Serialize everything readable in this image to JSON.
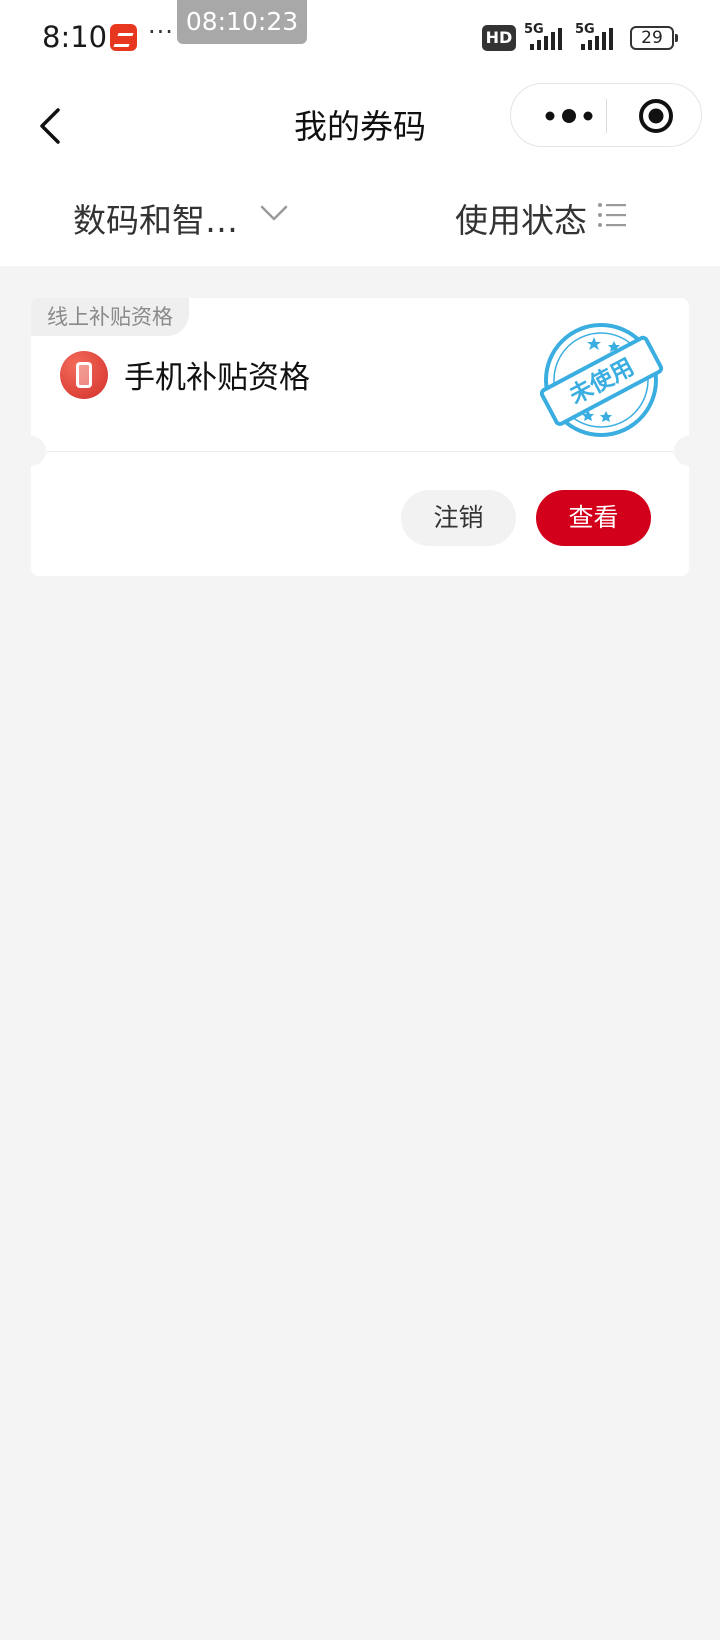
{
  "status_bar": {
    "time": "8:10",
    "overflow": "···",
    "clock_overlay": "08:10:23",
    "hd_label": "HD",
    "network1": "5G",
    "network2": "5G",
    "battery": "29"
  },
  "nav": {
    "title": "我的券码",
    "back_icon": "chevron-left-icon",
    "more_icon": "more-dots-icon",
    "close_icon": "target-circle-icon"
  },
  "filters": {
    "category": "数码和智…",
    "status": "使用状态"
  },
  "voucher": {
    "tag": "线上补贴资格",
    "name": "手机补贴资格",
    "stamp_text": "未使用",
    "stamp_color": "#3aaee0",
    "cancel_label": "注销",
    "view_label": "查看",
    "accent": "#d3001b"
  }
}
